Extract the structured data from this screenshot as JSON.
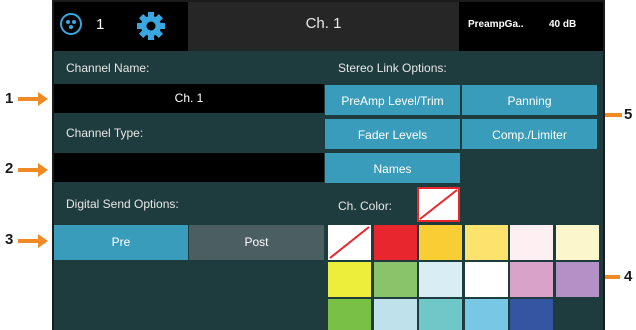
{
  "header": {
    "channel_number": "1",
    "title": "Ch. 1",
    "preamp_label": "PreampGa..",
    "preamp_value": "40 dB"
  },
  "left_panel": {
    "channel_name_label": "Channel Name:",
    "channel_name_value": "Ch. 1",
    "channel_type_label": "Channel Type:",
    "channel_type_value": "",
    "digital_send_label": "Digital Send Options:",
    "send_options": [
      "Pre",
      "Post"
    ],
    "selected_send": "Pre"
  },
  "right_panel": {
    "stereo_link_label": "Stereo Link Options:",
    "stereo_link_buttons": [
      "PreAmp Level/Trim",
      "Panning",
      "Fader Levels",
      "Comp./Limiter",
      "Names"
    ],
    "color_label": "Ch. Color:",
    "swatch_colors": [
      "none",
      "#e8262d",
      "#f9cd34",
      "#fbe36e",
      "#fdeff2",
      "#fbf6cc",
      "#eded3b",
      "#8ac46a",
      "#d9eef4",
      "#ffffff",
      "#d9a3c9",
      "#b390c5",
      "#79c144",
      "#bfe1ec",
      "#6fc7c7",
      "#78c7e4",
      "#3456a2"
    ]
  },
  "callouts": [
    "1",
    "2",
    "3",
    "4",
    "5"
  ],
  "colors": {
    "accent": "#3a9cbb",
    "panel": "#1e3b3d",
    "arrow": "#f08a24"
  }
}
